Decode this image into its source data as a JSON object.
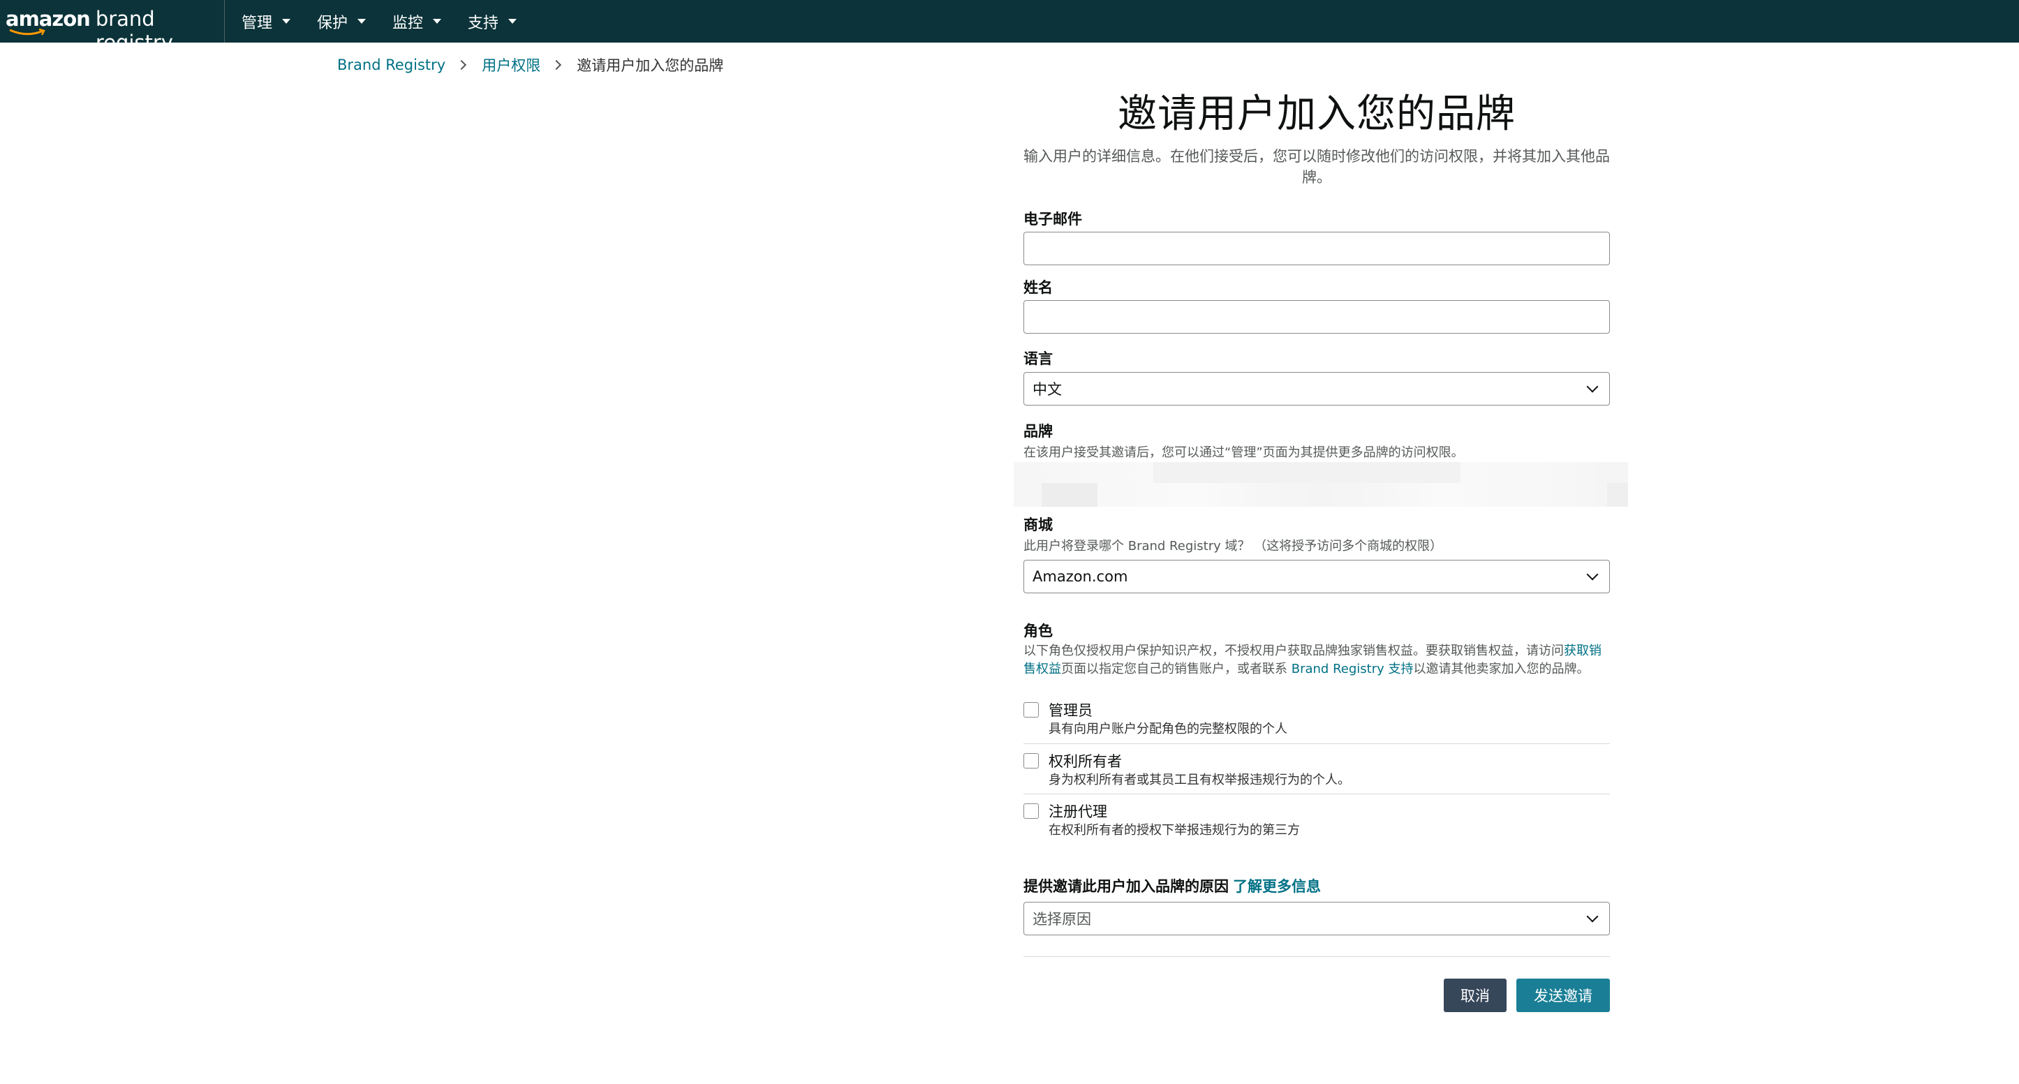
{
  "nav": {
    "logo_amazon": "amazon",
    "logo_product": "brand registry",
    "menu": [
      {
        "label": "管理"
      },
      {
        "label": "保护"
      },
      {
        "label": "监控"
      },
      {
        "label": "支持"
      }
    ]
  },
  "breadcrumb": {
    "root": "Brand Registry",
    "parent": "用户权限",
    "current": "邀请用户加入您的品牌"
  },
  "form": {
    "title": "邀请用户加入您的品牌",
    "subtitle_line1": "输入用户的详细信息。在他们接受后，您可以随时修改他们的访问权限，并将其加入其他品",
    "subtitle_line2": "牌。",
    "email_label": "电子邮件",
    "email_value": "",
    "name_label": "姓名",
    "name_value": "",
    "language_label": "语言",
    "language_value": "中文",
    "brand_label": "品牌",
    "brand_hint": "在该用户接受其邀请后，您可以通过“管理”页面为其提供更多品牌的访问权限。",
    "marketplace_label": "商城",
    "marketplace_hint": "此用户将登录哪个 Brand Registry 域？ （这将授予访问多个商城的权限）",
    "marketplace_value": "Amazon.com",
    "role_label": "角色",
    "role_text_1": "以下角色仅授权用户保护知识产权，不授权用户获取品牌独家销售权益。要获取销售权益，请访问",
    "role_link_1a": "获取销",
    "role_link_1b": "售权益",
    "role_text_2": "页面以指定您自己的销售账户，或者联系 ",
    "role_link_2": "Brand Registry 支持",
    "role_text_3": "以邀请其他卖家加入您的品牌。",
    "roles": [
      {
        "name": "管理员",
        "desc": "具有向用户账户分配角色的完整权限的个人"
      },
      {
        "name": "权利所有者",
        "desc": "身为权利所有者或其员工且有权举报违规行为的个人。"
      },
      {
        "name": "注册代理",
        "desc": "在权利所有者的授权下举报违规行为的第三方"
      }
    ],
    "reason_label": "提供邀请此用户加入品牌的原因",
    "reason_link": "了解更多信息",
    "reason_placeholder": "选择原因",
    "cancel_label": "取消",
    "send_label": "发送邀请"
  },
  "colors": {
    "nav_bg": "#0b3339",
    "link": "#007185",
    "cancel_btn": "#37475a",
    "send_btn": "#1a7f96"
  }
}
